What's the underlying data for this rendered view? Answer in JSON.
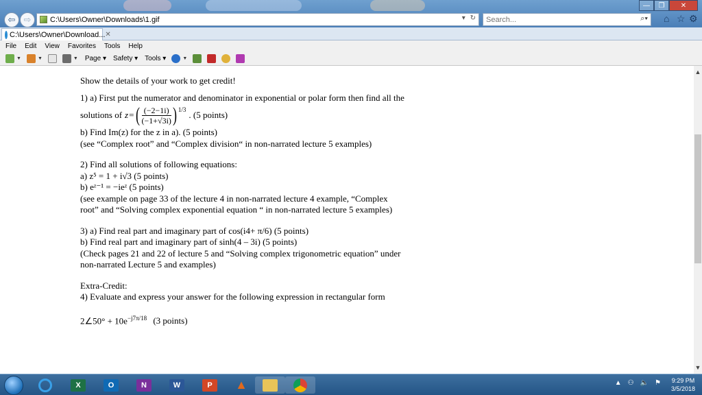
{
  "browser": {
    "address": "C:\\Users\\Owner\\Downloads\\1.gif",
    "search_placeholder": "Search...",
    "tab_label": "C:\\Users\\Owner\\Download...",
    "tab_close": "✕",
    "menu": [
      "File",
      "Edit",
      "View",
      "Favorites",
      "Tools",
      "Help"
    ],
    "command": {
      "page": "Page",
      "safety": "Safety",
      "tools": "Tools"
    }
  },
  "document": {
    "intro": "Show the details of your work to get credit!",
    "q1": {
      "a_line": "1) a) First put the numerator and denominator in exponential or polar form then find all the",
      "solutions_label": "solutions of",
      "numerator": "(−2−1i)",
      "denominator": "(−1+√3i)",
      "exponent": "1/3",
      "points": ". (5 points)",
      "b_line": "b) Find Im(z) for the z in a). (5 points)",
      "see_line": "(see “Complex root” and “Complex division“ in non-narrated lecture 5 examples)"
    },
    "q2": {
      "title": "2) Find all solutions of following equations:",
      "a_line": "a) z⁵ = 1 + i√3  (5 points)",
      "b_line": "b) eᶻ⁻¹ = −ieᶻ  (5 points)",
      "see1": "(see example on page 33 of the lecture 4 in non-narrated lecture 4 example, “Complex",
      "see2": "root” and “Solving complex exponential equation “ in non-narrated lecture 5 examples)"
    },
    "q3": {
      "a_line": "3) a) Find real part and imaginary part of cos(i4+ π/6) (5 points)",
      "b_line": "b) Find real part and imaginary part of sinh(4 – 3i) (5 points)",
      "check1": "(Check pages 21 and 22 of lecture 5 and “Solving complex trigonometric equation” under",
      "check2": "non-narrated Lecture 5 and examples)"
    },
    "extra": {
      "title": "Extra-Credit:",
      "q4": "4) Evaluate and express your answer for the following expression in rectangular form",
      "expr": "2∠50° + 10e",
      "expr_exp": "−j7π/18",
      "points": "(3 points)"
    }
  },
  "taskbar": {
    "apps": [
      "X",
      "O",
      "N",
      "W",
      "P"
    ],
    "time": "9:29 PM",
    "date": "3/5/2018"
  }
}
